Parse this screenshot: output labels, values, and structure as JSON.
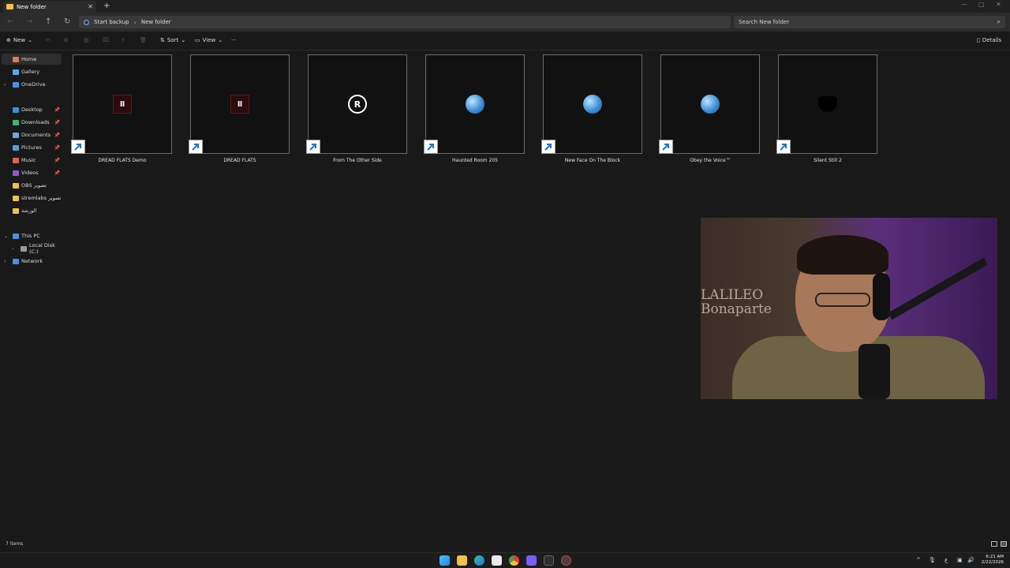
{
  "window": {
    "tab_title": "New folder",
    "tab_close": "✕",
    "new_tab": "+"
  },
  "address_bar": {
    "crumbs": [
      "Start backup",
      "New folder"
    ],
    "separator": "›"
  },
  "search": {
    "placeholder": "Search New folder"
  },
  "toolbar": {
    "new_label": "New",
    "sort_label": "Sort",
    "view_label": "View",
    "more_label": "···",
    "details_label": "Details"
  },
  "sidebar": {
    "items": [
      {
        "label": "Home",
        "icon": "home-icon",
        "color": "#e07a4a",
        "active": true
      },
      {
        "label": "Gallery",
        "icon": "gallery-icon",
        "color": "#5aa7e8"
      },
      {
        "label": "OneDrive",
        "icon": "cloud-icon",
        "color": "#4a90e2"
      },
      {
        "label": "Desktop",
        "icon": "desktop-icon",
        "color": "#3b8fd9"
      },
      {
        "label": "Downloads",
        "icon": "download-icon",
        "color": "#3fb37f"
      },
      {
        "label": "Documents",
        "icon": "document-icon",
        "color": "#6fa8dc"
      },
      {
        "label": "Pictures",
        "icon": "picture-icon",
        "color": "#4aa3df"
      },
      {
        "label": "Music",
        "icon": "music-icon",
        "color": "#e0605a"
      },
      {
        "label": "Videos",
        "icon": "video-icon",
        "color": "#8a5ad6"
      },
      {
        "label": "OBS تصوير",
        "icon": "folder-icon",
        "color": "#f0c24b"
      },
      {
        "label": "stremlabs تصوير",
        "icon": "folder-icon",
        "color": "#f0c24b"
      },
      {
        "label": "الورشة",
        "icon": "folder-icon",
        "color": "#f0c24b"
      },
      {
        "label": "This PC",
        "icon": "pc-icon",
        "color": "#4a90e2"
      },
      {
        "label": "Local Disk (C:)",
        "icon": "disk-icon",
        "color": "#9a9a9a"
      },
      {
        "label": "Network",
        "icon": "network-icon",
        "color": "#4a90e2"
      }
    ]
  },
  "files": [
    {
      "name": "DREAD FLATS Demo",
      "icon": "dread-flats-icon"
    },
    {
      "name": "DREAD FLATS",
      "icon": "dread-flats-icon"
    },
    {
      "name": "From The Other Side",
      "icon": "fa-logo-icon"
    },
    {
      "name": "Haunted Room  205",
      "icon": "globe-icon"
    },
    {
      "name": "New Face On The Block",
      "icon": "globe-icon"
    },
    {
      "name": "Obey the Voice™",
      "icon": "globe-icon"
    },
    {
      "name": "Silent Still 2",
      "icon": "silent-mask-icon"
    }
  ],
  "dread_glyph": "Ⅱ",
  "fa_glyph": "R",
  "webcam": {
    "wall_text_line1": "LALILEO",
    "wall_text_line2": "Bonaparte"
  },
  "status": {
    "item_count": "7 items"
  },
  "clock": {
    "time": "6:21 AM",
    "date": "2/22/2026"
  },
  "tray": {
    "lang": "ع"
  }
}
